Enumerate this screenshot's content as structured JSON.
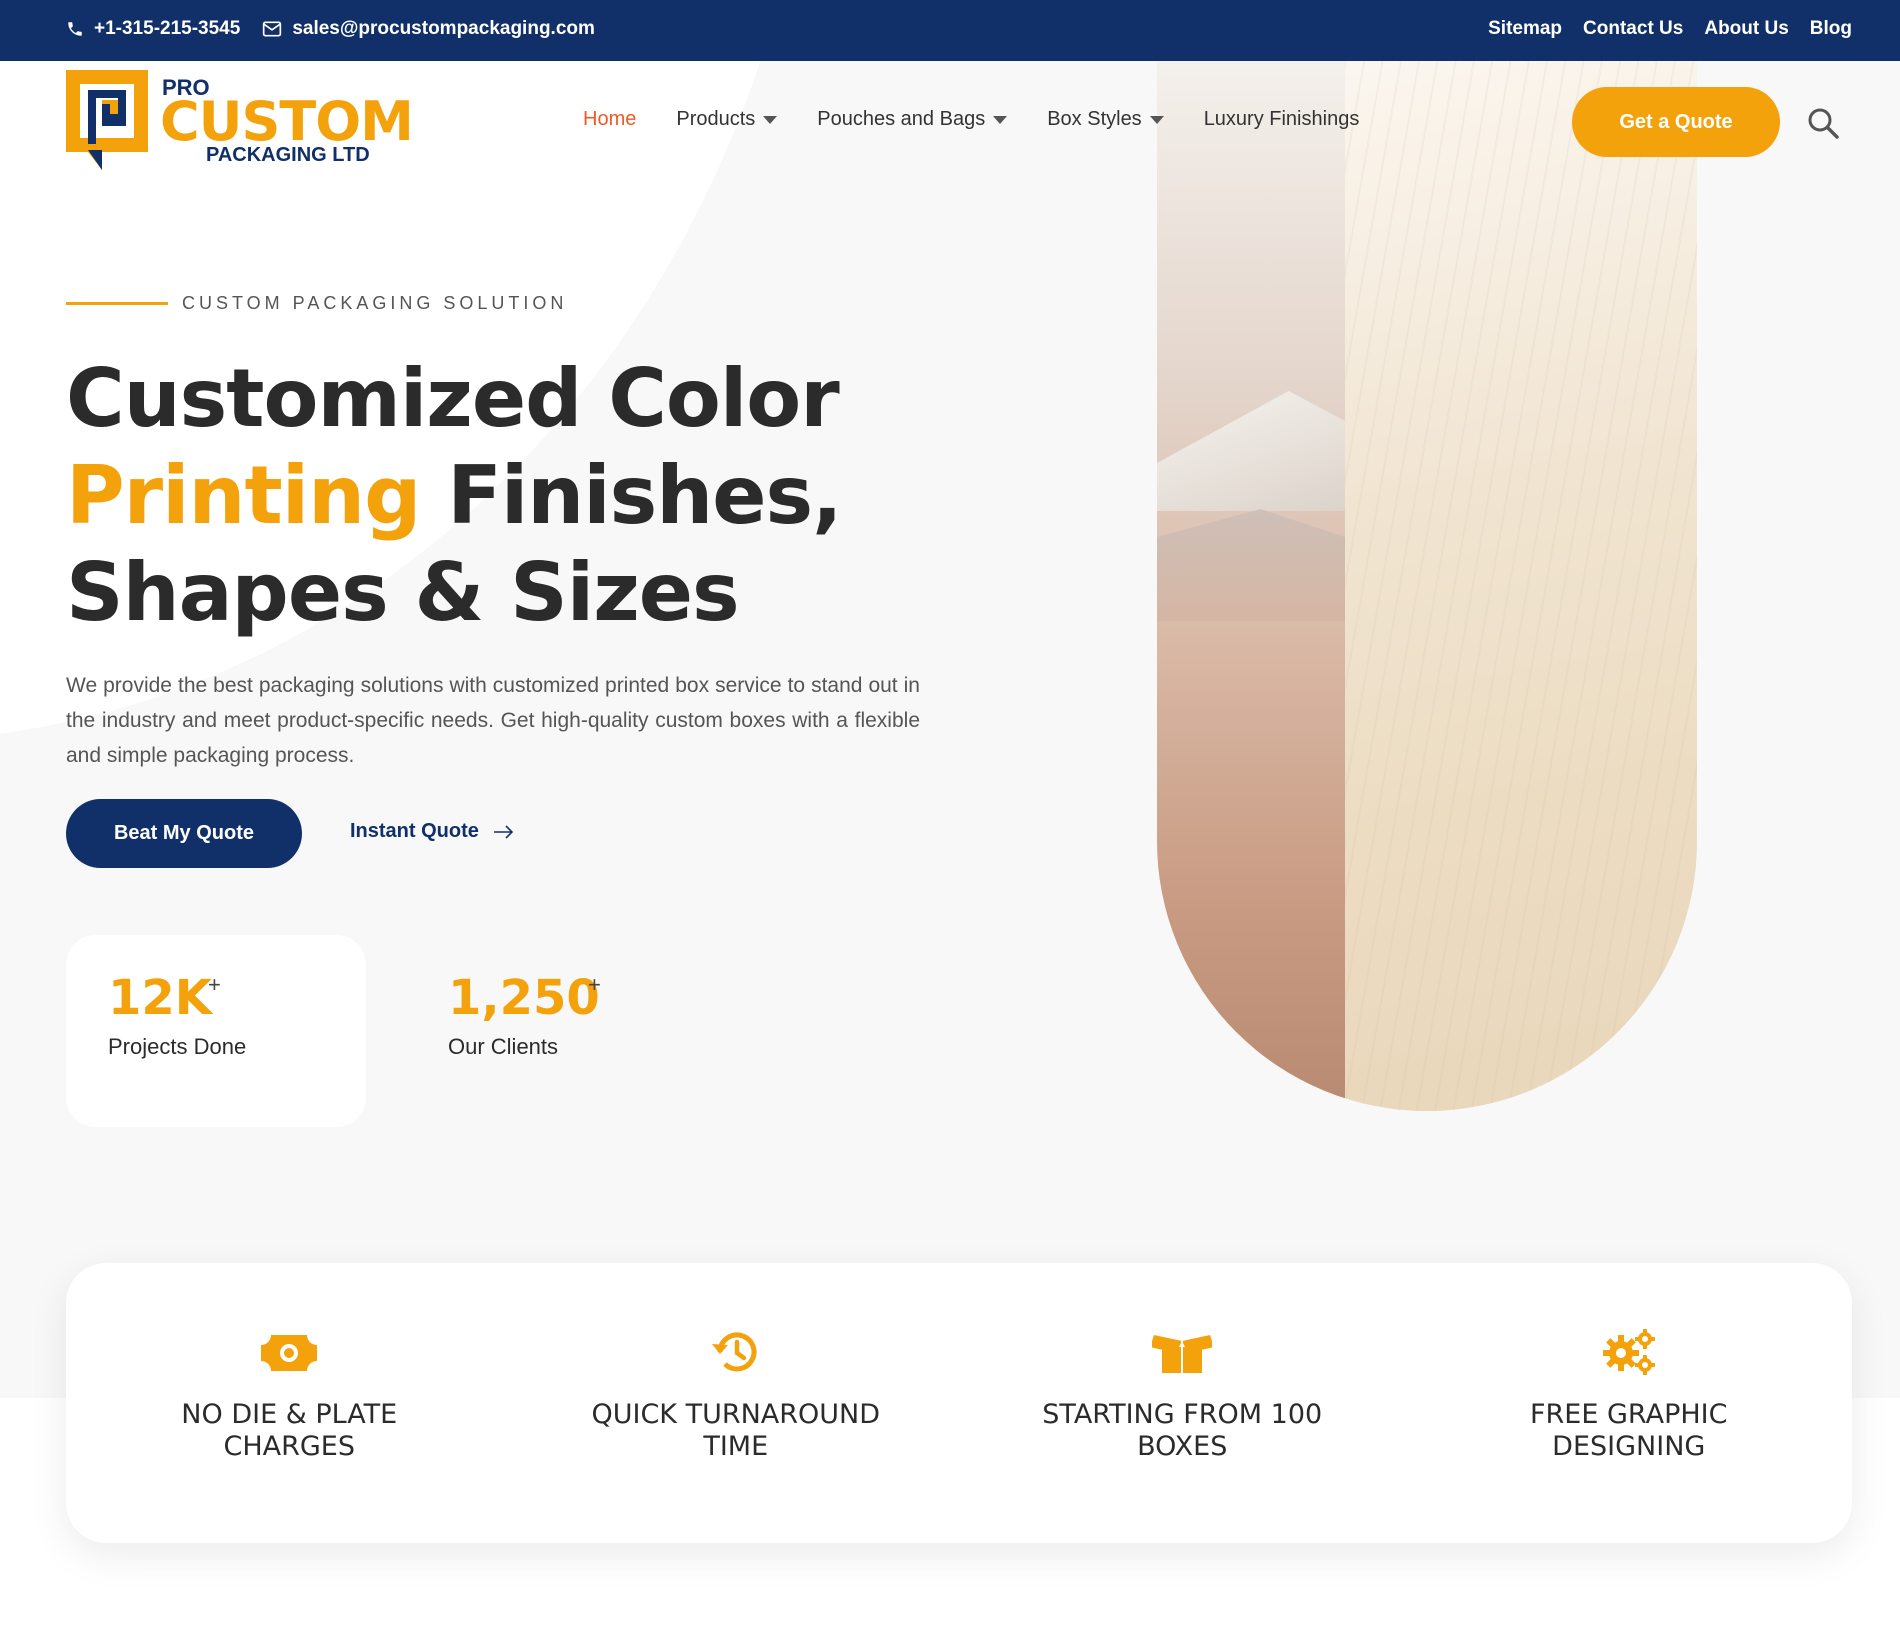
{
  "topbar": {
    "phone": "+1-315-215-3545",
    "email": "sales@procustompackaging.com",
    "links": [
      "Sitemap",
      "Contact Us",
      "About Us",
      "Blog"
    ]
  },
  "logo": {
    "line1": "PRO",
    "line2": "CUSTOM",
    "line3": "PACKAGING LTD"
  },
  "nav": {
    "items": [
      {
        "label": "Home",
        "active": true,
        "dropdown": false
      },
      {
        "label": "Products",
        "dropdown": true
      },
      {
        "label": "Pouches and Bags",
        "dropdown": true
      },
      {
        "label": "Box Styles",
        "dropdown": true
      },
      {
        "label": "Luxury Finishings",
        "dropdown": false
      }
    ],
    "cta": "Get a Quote"
  },
  "hero": {
    "eyebrow": "CUSTOM PACKAGING SOLUTION",
    "headline_part1": "Customized Color",
    "headline_accent": "Printing",
    "headline_part2": " Finishes,",
    "headline_part3": "Shapes & Sizes",
    "description": "We provide the best packaging solutions with customized printed box service to stand out in the industry and meet product-specific needs. Get high-quality custom boxes with a flexible and simple packaging process.",
    "primary_button": "Beat My Quote",
    "secondary_link": "Instant Quote"
  },
  "stats": [
    {
      "value": "12K",
      "suffix": "+",
      "label": "Projects Done"
    },
    {
      "value": "1,250",
      "suffix": "+",
      "label": "Our Clients"
    }
  ],
  "features": [
    {
      "icon": "money-bill-icon",
      "title": "NO DIE & PLATE CHARGES"
    },
    {
      "icon": "history-icon",
      "title": "QUICK TURNAROUND TIME"
    },
    {
      "icon": "box-open-icon",
      "title": "STARTING FROM 100 BOXES"
    },
    {
      "icon": "gears-icon",
      "title": "FREE GRAPHIC DESIGNING"
    }
  ],
  "colors": {
    "navy": "#11306a",
    "orange": "#f4a20c",
    "active_nav": "#ef5a24"
  }
}
